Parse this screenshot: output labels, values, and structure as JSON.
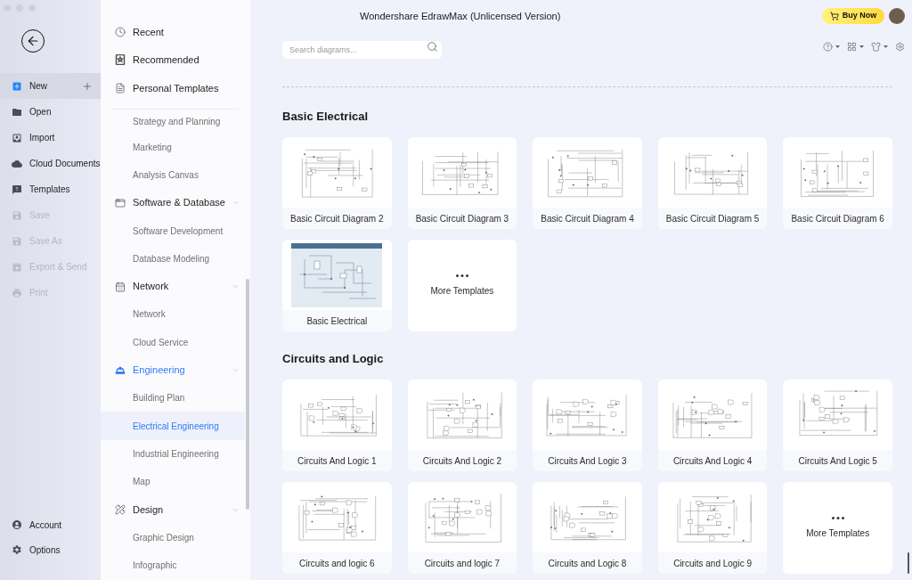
{
  "window": {
    "title": "Wondershare EdrawMax (Unlicensed Version)",
    "buy_button": "Buy Now"
  },
  "app_menu": {
    "items": [
      {
        "label": "New",
        "selected": true,
        "disabled": false
      },
      {
        "label": "Open",
        "selected": false,
        "disabled": false
      },
      {
        "label": "Import",
        "selected": false,
        "disabled": false
      },
      {
        "label": "Cloud Documents",
        "selected": false,
        "disabled": false
      },
      {
        "label": "Templates",
        "selected": false,
        "disabled": false
      },
      {
        "label": "Save",
        "selected": false,
        "disabled": true
      },
      {
        "label": "Save As",
        "selected": false,
        "disabled": true
      },
      {
        "label": "Export & Send",
        "selected": false,
        "disabled": true
      },
      {
        "label": "Print",
        "selected": false,
        "disabled": true
      }
    ],
    "footer_items": [
      {
        "label": "Account",
        "selected": false
      },
      {
        "label": "Options",
        "selected": false
      }
    ]
  },
  "category_nav": {
    "top_items": [
      {
        "label": "Recent",
        "selected": false
      },
      {
        "label": "Recommended",
        "selected": false
      },
      {
        "label": "Personal Templates",
        "selected": false
      }
    ],
    "groups": [
      {
        "items": [
          {
            "label": "Strategy and Planning",
            "selected": false
          },
          {
            "label": "Marketing",
            "selected": false
          },
          {
            "label": "Analysis Canvas",
            "selected": false
          }
        ]
      },
      {
        "label": "Software & Database",
        "expanded": true,
        "active": false,
        "items": [
          {
            "label": "Software Development",
            "selected": false
          },
          {
            "label": "Database Modeling",
            "selected": false
          }
        ]
      },
      {
        "label": "Network",
        "expanded": true,
        "active": false,
        "items": [
          {
            "label": "Network",
            "selected": false
          },
          {
            "label": "Cloud Service",
            "selected": false
          }
        ]
      },
      {
        "label": "Engineering",
        "expanded": true,
        "active": true,
        "items": [
          {
            "label": "Building Plan",
            "selected": false
          },
          {
            "label": "Electrical Engineering",
            "selected": true
          },
          {
            "label": "Industrial Engineering",
            "selected": false
          },
          {
            "label": "Map",
            "selected": false
          }
        ]
      },
      {
        "label": "Design",
        "expanded": true,
        "active": false,
        "items": [
          {
            "label": "Graphic Design",
            "selected": false
          },
          {
            "label": "Infographic",
            "selected": false
          }
        ]
      }
    ]
  },
  "search": {
    "placeholder": "Search diagrams..."
  },
  "sections": [
    {
      "title": "Basic Electrical",
      "cards": [
        {
          "kind": "template",
          "label": "Basic Circuit Diagram 2"
        },
        {
          "kind": "template",
          "label": "Basic Circuit Diagram 3"
        },
        {
          "kind": "template",
          "label": "Basic Circuit Diagram 4"
        },
        {
          "kind": "template",
          "label": "Basic Circuit Diagram 5"
        },
        {
          "kind": "template",
          "label": "Basic Circuit Diagram 6"
        },
        {
          "kind": "template",
          "label": "Basic Electrical"
        },
        {
          "kind": "more",
          "label": "More Templates"
        }
      ]
    },
    {
      "title": "Circuits and Logic",
      "cards": [
        {
          "kind": "template",
          "label": "Circuits And Logic 1"
        },
        {
          "kind": "template",
          "label": "Circuits And Logic 2"
        },
        {
          "kind": "template",
          "label": "Circuits And Logic 3"
        },
        {
          "kind": "template",
          "label": "Circuits And Logic 4"
        },
        {
          "kind": "template",
          "label": "Circuits And Logic 5"
        },
        {
          "kind": "template",
          "label": "Circuits and logic 6"
        },
        {
          "kind": "template",
          "label": "Circuits and logic 7"
        },
        {
          "kind": "template",
          "label": "Circuits and Logic 8"
        },
        {
          "kind": "template",
          "label": "Circuits and Logic 9"
        },
        {
          "kind": "more",
          "label": "More Templates"
        }
      ]
    }
  ]
}
